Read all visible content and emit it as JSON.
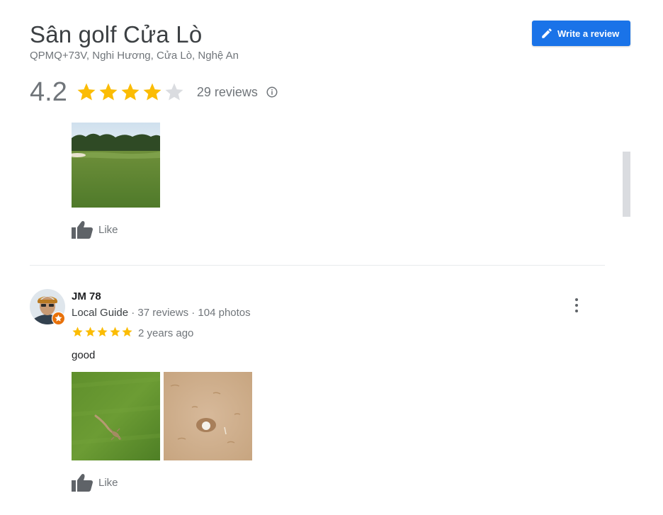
{
  "place": {
    "title": "Sân golf Cửa Lò",
    "address": "QPMQ+73V, Nghi Hương, Cửa Lò, Nghệ An",
    "write_review_label": "Write a review",
    "rating_value": "4.2",
    "rating_numeric": 4.2,
    "stars_filled": 4,
    "review_count_label": "29 reviews",
    "colors": {
      "accent": "#1a73e8",
      "star": "#fbbc04",
      "star_empty": "#dadce0",
      "muted_text": "#70757a",
      "badge": "#e8710a"
    }
  },
  "previous_review": {
    "photo_icon": "golf-course-photo",
    "like_label": "Like"
  },
  "review": {
    "author_name": "JM 78",
    "author_guide": "Local Guide",
    "author_stats": " · 37 reviews · 104 photos",
    "rating": 5,
    "time": "2 years ago",
    "text": "good",
    "photos": [
      "lizard-on-grass-photo",
      "golf-ball-in-sand-photo"
    ],
    "like_label": "Like",
    "more_icon": "more-vert-icon"
  }
}
